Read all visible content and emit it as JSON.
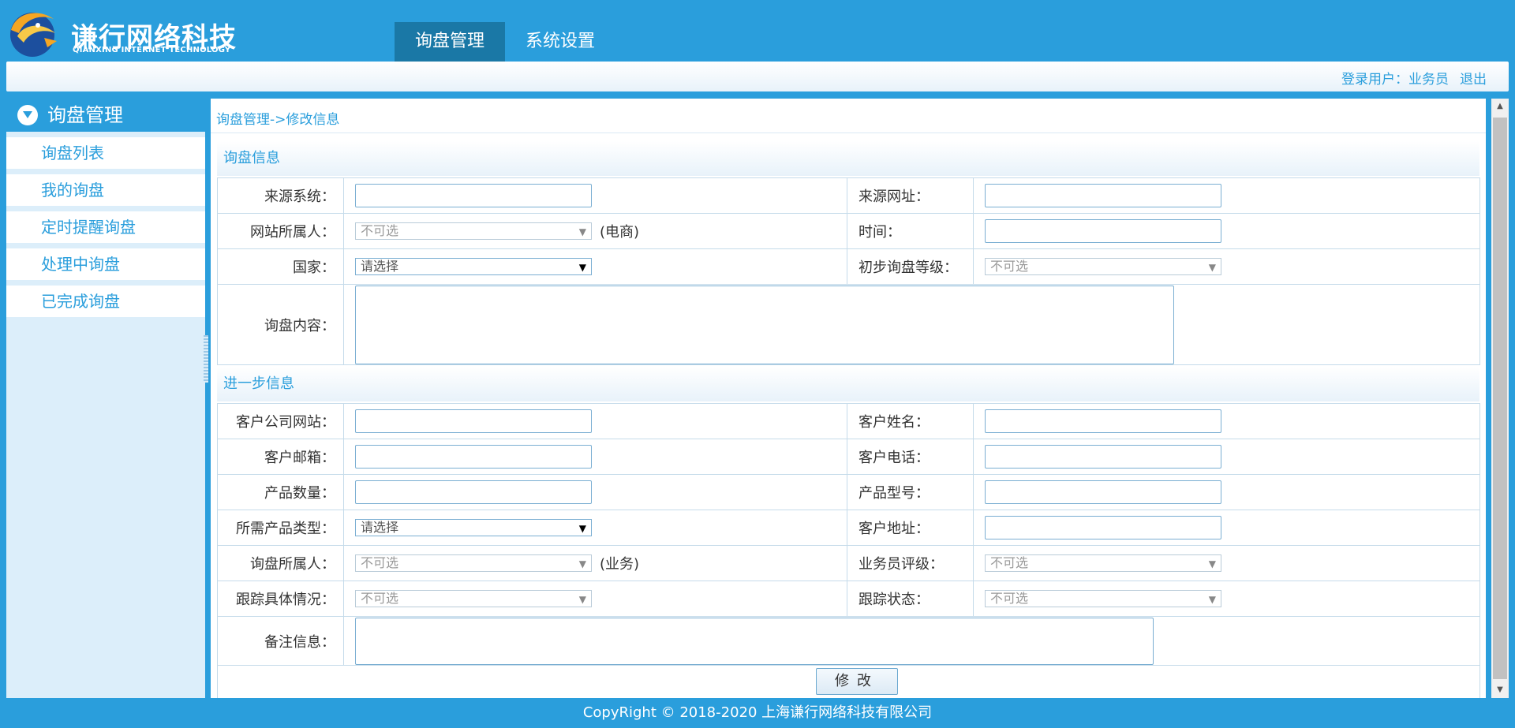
{
  "brand": {
    "name_cn": "谦行网络科技",
    "name_en": "QIANXING INTERNET TECHNOLOGY"
  },
  "topnav": {
    "tabs": [
      {
        "label": "询盘管理",
        "active": true
      },
      {
        "label": "系统设置",
        "active": false
      }
    ]
  },
  "userbar": {
    "user_label": "登录用户：业务员",
    "logout": "退出"
  },
  "sidebar": {
    "title": "询盘管理",
    "items": [
      {
        "label": "询盘列表"
      },
      {
        "label": "我的询盘"
      },
      {
        "label": "定时提醒询盘"
      },
      {
        "label": "处理中询盘"
      },
      {
        "label": "已完成询盘"
      }
    ]
  },
  "breadcrumb": "询盘管理->修改信息",
  "section1": {
    "title": "询盘信息",
    "source_system": "来源系统：",
    "source_url": "来源网址：",
    "site_owner": "网站所属人：",
    "site_owner_value": "不可选",
    "site_owner_suffix": "(电商)",
    "time": "时间：",
    "country": "国家：",
    "country_value": "请选择",
    "init_level": "初步询盘等级：",
    "init_level_value": "不可选",
    "content": "询盘内容："
  },
  "section2": {
    "title": "进一步信息",
    "company_site": "客户公司网站：",
    "customer_name": "客户姓名：",
    "email": "客户邮箱：",
    "phone": "客户电话：",
    "quantity": "产品数量：",
    "model": "产品型号：",
    "product_type": "所需产品类型：",
    "product_type_value": "请选择",
    "address": "客户地址：",
    "inquiry_owner": "询盘所属人：",
    "inquiry_owner_value": "不可选",
    "inquiry_owner_suffix": "(业务)",
    "sales_rating": "业务员评级：",
    "sales_rating_value": "不可选",
    "track_detail": "跟踪具体情况：",
    "track_detail_value": "不可选",
    "track_status": "跟踪状态：",
    "track_status_value": "不可选",
    "remark": "备注信息："
  },
  "submit_label": "修改",
  "footer": "CopyRight © 2018-2020 上海谦行网络科技有限公司",
  "colors": {
    "brand_blue": "#2a9edc",
    "active_tab": "#1a78a6",
    "sidebar_bg": "#dceefa",
    "border": "#c5dbea"
  }
}
